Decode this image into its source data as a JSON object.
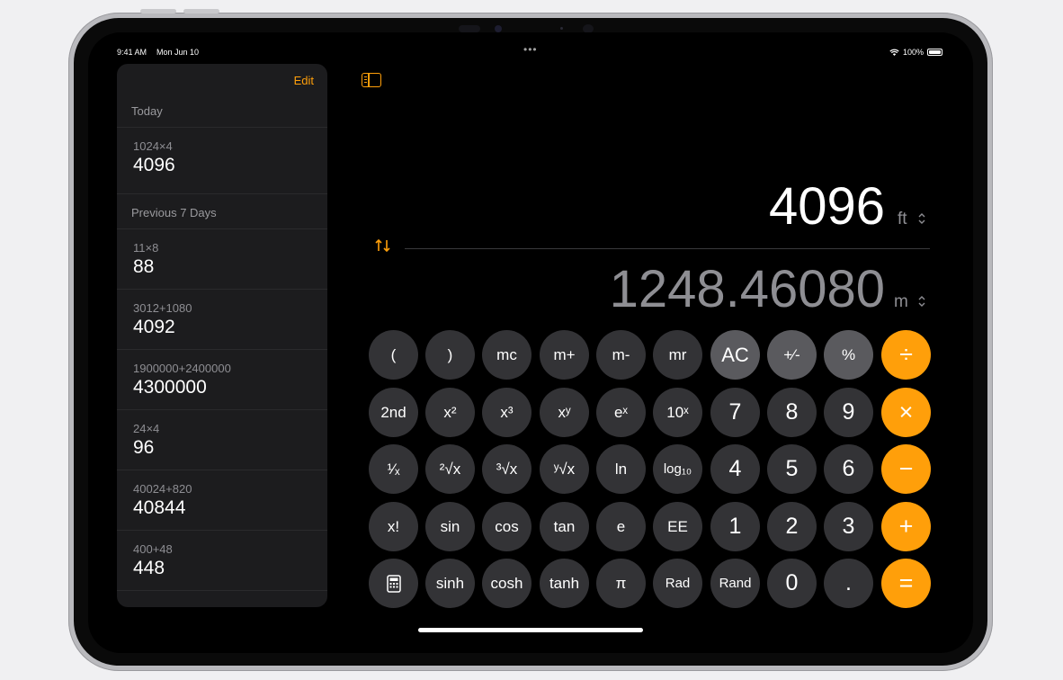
{
  "status": {
    "time": "9:41 AM",
    "date": "Mon Jun 10",
    "battery": "100%",
    "dots": "•••"
  },
  "sidebar": {
    "edit_label": "Edit",
    "section_today": "Today",
    "section_previous": "Previous 7 Days",
    "entries": [
      {
        "expr": "1024×4",
        "result": "4096"
      },
      {
        "expr": "11×8",
        "result": "88"
      },
      {
        "expr": "3012+1080",
        "result": "4092"
      },
      {
        "expr": "1900000+2400000",
        "result": "4300000"
      },
      {
        "expr": "24×4",
        "result": "96"
      },
      {
        "expr": "40024+820",
        "result": "40844"
      },
      {
        "expr": "400+48",
        "result": "448"
      }
    ]
  },
  "display": {
    "top_value": "4096",
    "top_unit": "ft",
    "bottom_value": "1248.46080",
    "bottom_unit": "m",
    "chevron": "⌃⌄"
  },
  "keys": {
    "r1": [
      "(",
      ")",
      "mc",
      "m+",
      "m-",
      "mr",
      "AC",
      "+⁄-",
      "%",
      "÷"
    ],
    "r2": [
      "2nd",
      "x²",
      "x³",
      "xʸ",
      "eˣ",
      "10ˣ",
      "7",
      "8",
      "9",
      "×"
    ],
    "r3": [
      "¹⁄ₓ",
      "²√x",
      "³√x",
      "ʸ√x",
      "ln",
      "log₁₀",
      "4",
      "5",
      "6",
      "−"
    ],
    "r4": [
      "x!",
      "sin",
      "cos",
      "tan",
      "e",
      "EE",
      "1",
      "2",
      "3",
      "+"
    ],
    "r5": [
      "▦",
      "sinh",
      "cosh",
      "tanh",
      "π",
      "Rad",
      "Rand",
      "0",
      ".",
      "="
    ]
  },
  "colors": {
    "accent": "#ff9f0a",
    "key": "#333336",
    "key_function": "#5a5a5e"
  }
}
